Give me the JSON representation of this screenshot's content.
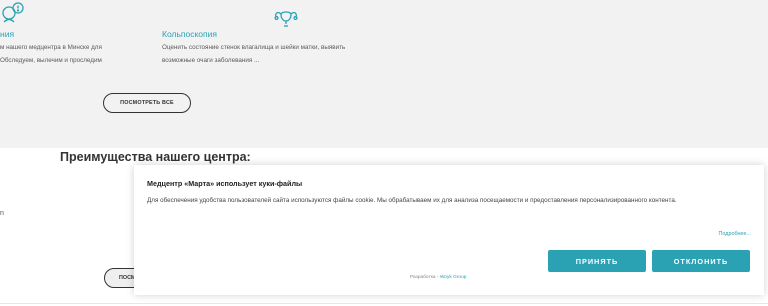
{
  "services": {
    "left_card": {
      "title": "ния",
      "desc_line1": "м нашего медцентра в Минске для",
      "desc_line2": "Обследуем, вылечим и проследим"
    },
    "right_card": {
      "icon": "uterus-icon",
      "title": "Кольпоскопия",
      "desc_line1": "Оценить состояние стенок влагалища и шейки матки, выявить",
      "desc_line2": "возможные очаги заболевания ..."
    },
    "view_all_label": "ПОСМОТРЕТЬ ВСЕ"
  },
  "advantages": {
    "title": "Преимущества нашего центра:",
    "stray_mark": "n",
    "partial_button_label": "ПОСМ"
  },
  "cookie_banner": {
    "title": "Медцентр «Марта» использует куки-файлы",
    "text": "Для обеспечения удобства пользователей сайта используются файлы cookie. Мы обрабатываем их для анализа посещаемости и предоставления персонализированного контента.",
    "more_link": "Подробнее...",
    "accept_label": "ПРИНЯТЬ",
    "decline_label": "ОТКЛОНИТЬ",
    "developer_prefix": "Разработка - ",
    "developer_name": "Woyk Group"
  },
  "colors": {
    "accent": "#2aa2b3",
    "section_bg": "#f2f2f2"
  }
}
